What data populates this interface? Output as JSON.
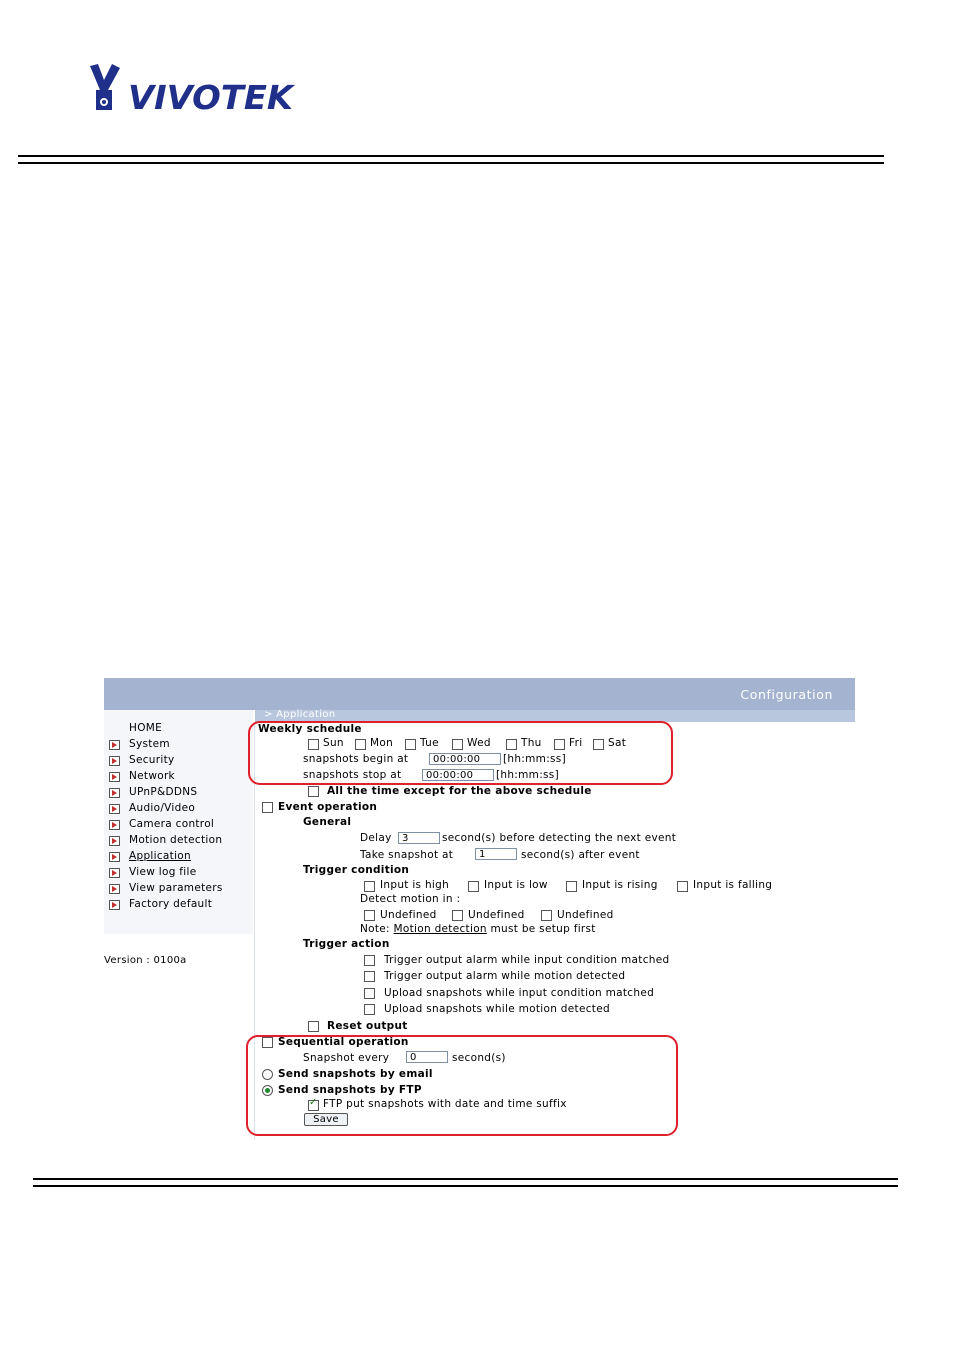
{
  "logo": {
    "text": "VIVOTEK"
  },
  "app": {
    "header_title": "Configuration",
    "breadcrumb": "> Application",
    "version": "Version : 0100a"
  },
  "nav": [
    {
      "label": "HOME",
      "arrow": false
    },
    {
      "label": "System",
      "arrow": true
    },
    {
      "label": "Security",
      "arrow": true
    },
    {
      "label": "Network",
      "arrow": true
    },
    {
      "label": "UPnP&DDNS",
      "arrow": true
    },
    {
      "label": "Audio/Video",
      "arrow": true
    },
    {
      "label": "Camera control",
      "arrow": true
    },
    {
      "label": "Motion detection",
      "arrow": true
    },
    {
      "label": "Application",
      "arrow": true,
      "current": true
    },
    {
      "label": "View log file",
      "arrow": true
    },
    {
      "label": "View parameters",
      "arrow": true
    },
    {
      "label": "Factory default",
      "arrow": true
    }
  ],
  "weekly": {
    "title": "Weekly schedule",
    "days": [
      {
        "label": "Sun",
        "checked": false
      },
      {
        "label": "Mon",
        "checked": false
      },
      {
        "label": "Tue",
        "checked": false
      },
      {
        "label": "Wed",
        "checked": false
      },
      {
        "label": "Thu",
        "checked": false
      },
      {
        "label": "Fri",
        "checked": false
      },
      {
        "label": "Sat",
        "checked": false
      }
    ],
    "begin_label": "snapshots begin at",
    "begin_value": "00:00:00",
    "begin_hint": "[hh:mm:ss]",
    "stop_label": "snapshots stop at",
    "stop_value": "00:00:00",
    "stop_hint": "[hh:mm:ss]",
    "all_time_label": "All the time except for the above schedule"
  },
  "event": {
    "title": "Event operation",
    "general_title": "General",
    "delay_label": "Delay",
    "delay_value": "3",
    "delay_suffix": "second(s) before detecting the next event",
    "take_label": "Take snapshot at",
    "take_value": "1",
    "take_suffix": "second(s) after event",
    "trigger_condition_title": "Trigger condition",
    "inputs": [
      {
        "label": "Input is high",
        "checked": false
      },
      {
        "label": "Input is low",
        "checked": false
      },
      {
        "label": "Input is rising",
        "checked": false
      },
      {
        "label": "Input is falling",
        "checked": false
      }
    ],
    "detect_label": "Detect motion in :",
    "detect_regions": [
      {
        "label": "Undefined",
        "checked": false
      },
      {
        "label": "Undefined",
        "checked": false
      },
      {
        "label": "Undefined",
        "checked": false
      }
    ],
    "note_prefix": "Note:",
    "note_link": "Motion detection",
    "note_suffix": "must be setup first",
    "trigger_action_title": "Trigger action",
    "actions": [
      {
        "label": "Trigger output alarm while input condition matched",
        "checked": false
      },
      {
        "label": "Trigger output alarm while motion detected",
        "checked": false
      },
      {
        "label": "Upload snapshots while input condition matched",
        "checked": false
      },
      {
        "label": "Upload snapshots while motion detected",
        "checked": false
      }
    ],
    "reset_label": "Reset output"
  },
  "sequential": {
    "title": "Sequential operation",
    "every_label": "Snapshot every",
    "every_value": "0",
    "every_suffix": "second(s)"
  },
  "delivery": {
    "email_label": "Send snapshots by email",
    "email_selected": false,
    "ftp_label": "Send snapshots by FTP",
    "ftp_selected": true,
    "ftp_suffix_label": "FTP put snapshots with date and time suffix",
    "ftp_suffix_checked": true
  },
  "save_label": "Save",
  "colors": {
    "header_bar": "#a4b3cf",
    "highlight_outline": "#e0202a",
    "nav_arrow": "#c0302a"
  }
}
